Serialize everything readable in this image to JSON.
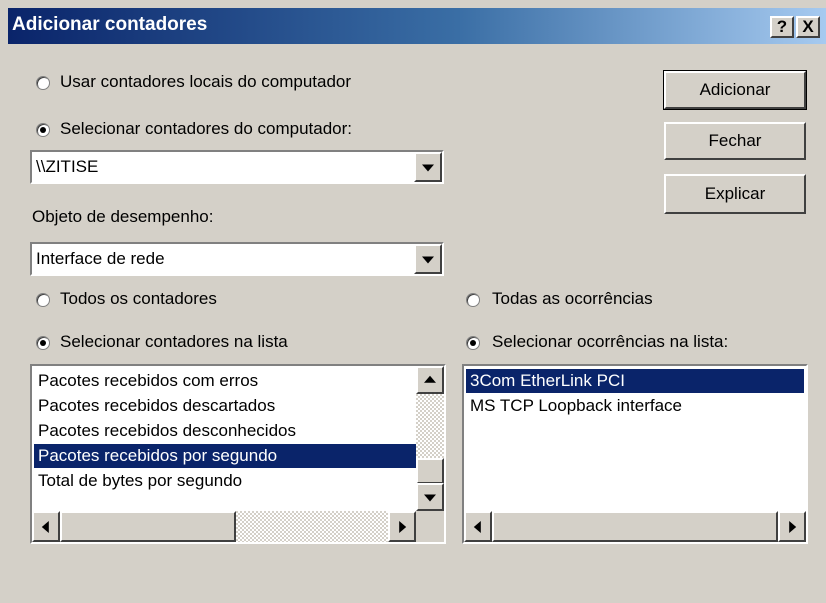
{
  "window": {
    "title": "Adicionar contadores",
    "help_label": "?",
    "close_label": "X"
  },
  "source": {
    "local_label": "Usar contadores locais do computador",
    "select_label": "Selecionar contadores do computador:",
    "computer_value": "\\\\ZITISE",
    "selected": "select"
  },
  "object": {
    "label": "Objeto de desempenho:",
    "value": "Interface de rede"
  },
  "counters": {
    "all_label": "Todos os contadores",
    "list_label": "Selecionar contadores na lista",
    "selected": "list",
    "items": [
      "Pacotes recebidos com erros",
      "Pacotes recebidos descartados",
      "Pacotes recebidos desconhecidos",
      "Pacotes recebidos por segundo",
      "Total de bytes por segundo"
    ],
    "selected_index": 3
  },
  "instances": {
    "all_label": "Todas as ocorrências",
    "list_label": "Selecionar ocorrências na lista:",
    "selected": "list",
    "items": [
      "3Com EtherLink PCI",
      "MS TCP Loopback interface"
    ],
    "selected_index": 0
  },
  "buttons": {
    "add": "Adicionar",
    "close": "Fechar",
    "explain": "Explicar"
  },
  "colors": {
    "title_start": "#0a246a",
    "title_end": "#a6caf0",
    "selection": "#0a246a",
    "face": "#d4d0c8"
  }
}
